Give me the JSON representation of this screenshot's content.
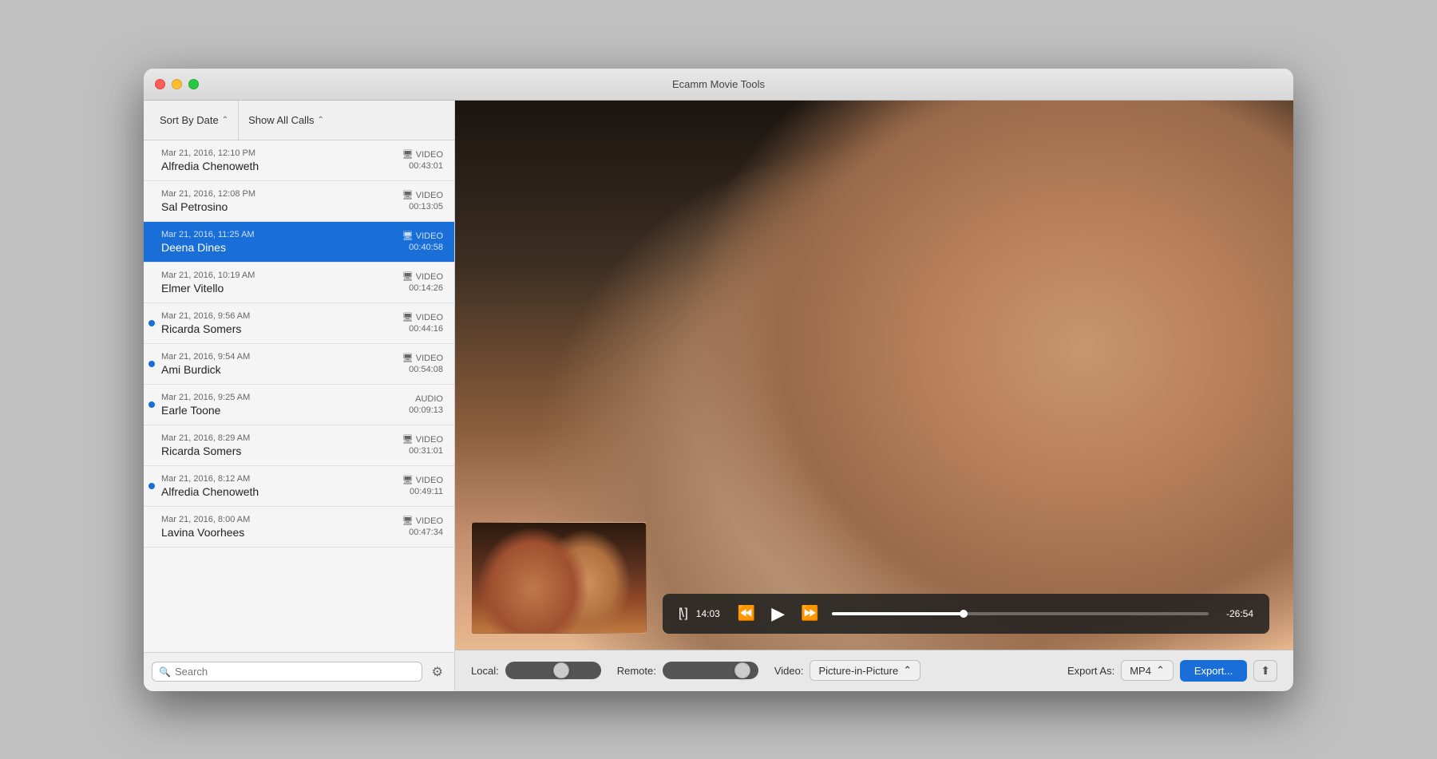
{
  "window": {
    "title": "Ecamm Movie Tools"
  },
  "toolbar": {
    "sort_label": "Sort By Date",
    "show_label": "Show All Calls",
    "sort_chevron": "⌃",
    "show_chevron": "⌃"
  },
  "calls": [
    {
      "id": 1,
      "date": "Mar 21, 2016, 12:10 PM",
      "name": "Alfredia Chenoweth",
      "type": "VIDEO",
      "duration": "00:43:01",
      "selected": false,
      "dot": false
    },
    {
      "id": 2,
      "date": "Mar 21, 2016, 12:08 PM",
      "name": "Sal Petrosino",
      "type": "VIDEO",
      "duration": "00:13:05",
      "selected": false,
      "dot": false
    },
    {
      "id": 3,
      "date": "Mar 21, 2016, 11:25 AM",
      "name": "Deena Dines",
      "type": "VIDEO",
      "duration": "00:40:58",
      "selected": true,
      "dot": false
    },
    {
      "id": 4,
      "date": "Mar 21, 2016, 10:19 AM",
      "name": "Elmer Vitello",
      "type": "VIDEO",
      "duration": "00:14:26",
      "selected": false,
      "dot": false
    },
    {
      "id": 5,
      "date": "Mar 21, 2016, 9:56 AM",
      "name": "Ricarda Somers",
      "type": "VIDEO",
      "duration": "00:44:16",
      "selected": false,
      "dot": true
    },
    {
      "id": 6,
      "date": "Mar 21, 2016, 9:54 AM",
      "name": "Ami Burdick",
      "type": "VIDEO",
      "duration": "00:54:08",
      "selected": false,
      "dot": true
    },
    {
      "id": 7,
      "date": "Mar 21, 2016, 9:25 AM",
      "name": "Earle Toone",
      "type": "AUDIO",
      "duration": "00:09:13",
      "selected": false,
      "dot": true
    },
    {
      "id": 8,
      "date": "Mar 21, 2016, 8:29 AM",
      "name": "Ricarda Somers",
      "type": "VIDEO",
      "duration": "00:31:01",
      "selected": false,
      "dot": false
    },
    {
      "id": 9,
      "date": "Mar 21, 2016, 8:12 AM",
      "name": "Alfredia Chenoweth",
      "type": "VIDEO",
      "duration": "00:49:11",
      "selected": false,
      "dot": true
    },
    {
      "id": 10,
      "date": "Mar 21, 2016, 8:00 AM",
      "name": "Lavina Voorhees",
      "type": "VIDEO",
      "duration": "00:47:34",
      "selected": false,
      "dot": false
    }
  ],
  "search": {
    "placeholder": "Search",
    "value": ""
  },
  "playback": {
    "time_current": "14:03",
    "time_remaining": "-26:54",
    "progress_percent": 35
  },
  "bottom_bar": {
    "local_label": "Local:",
    "remote_label": "Remote:",
    "video_label": "Video:",
    "video_mode": "Picture-in-Picture",
    "export_label": "Export As:",
    "export_format": "MP4",
    "export_btn": "Export...",
    "chevron": "⌃"
  }
}
